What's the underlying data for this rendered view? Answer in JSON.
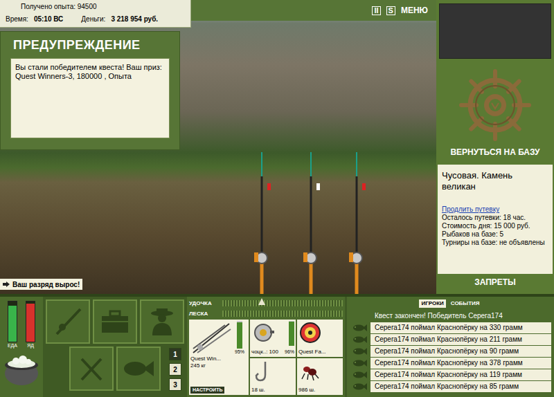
{
  "hud": {
    "experience": "Получено опыта: 94500",
    "time_label": "Время:",
    "time": "05:10 ВС",
    "money_label": "Деньги:",
    "money": "3 218 954 руб."
  },
  "top_bar": {
    "buttons": [
      "II",
      "S",
      "МЕНЮ"
    ]
  },
  "warning": {
    "title": "ПРЕДУПРЕЖДЕНИЕ",
    "message": "Вы стали победителем квеста! Ваш приз: Quest Winners-3, 180000 , Опыта"
  },
  "notification": "Ваш разряд вырос!",
  "base": {
    "return_button": "ВЕРНУТЬСЯ НА БАЗУ",
    "location": "Чусовая. Камень великан",
    "extend_link": "Продлить путевку",
    "details": [
      "Осталось путевки: 18 час.",
      "Стоимость дня: 15 000 руб.",
      "Рыбаков на базе: 5",
      "Турниры на базе: не объявлены"
    ],
    "bans_button": "ЗАПРЕТЫ"
  },
  "meters": [
    {
      "label": "ЕДА",
      "level": 0.9,
      "color": "#39b54a"
    },
    {
      "label": "ЯД",
      "level": 0.95,
      "color": "#d8322c"
    }
  ],
  "action_slots": [
    {
      "label": "1",
      "selected": true
    },
    {
      "label": "2",
      "selected": false
    },
    {
      "label": "3",
      "selected": false
    }
  ],
  "tension": [
    {
      "label": "УДОЧКА",
      "marker": true,
      "level": 0.3
    },
    {
      "label": "ЛЕСКА",
      "marker": false,
      "level": 0
    }
  ],
  "tackle": {
    "rod": {
      "name": "Quest Win...",
      "detail": "245 кг",
      "wear": "95%",
      "level": 0.95
    },
    "configure_button": "НАСТРОИТЬ",
    "items": [
      {
        "kind": "reel",
        "label": "чоцк..: 100",
        "wear": "96%",
        "level": 0.96
      },
      {
        "kind": "line",
        "label": "Quest Fa..."
      },
      {
        "kind": "hook",
        "label": "18 ш."
      },
      {
        "kind": "bait",
        "label": "986 ш."
      }
    ]
  },
  "feed": {
    "tabs": [
      {
        "label": "ИГРОКИ",
        "selected": true
      },
      {
        "label": "СОБЫТИЯ",
        "selected": false
      }
    ],
    "entries": [
      {
        "kind": "notice",
        "text": "Квест закончен! Победитель Серега174"
      },
      {
        "kind": "catch",
        "text": "Серега174 поймал Краснопёрку на 330 грамм"
      },
      {
        "kind": "catch",
        "text": "Серега174 поймал Краснопёрку на 211 грамм"
      },
      {
        "kind": "catch",
        "text": "Серега174 поймал Краснопёрку на 90 грамм"
      },
      {
        "kind": "catch",
        "text": "Серега174 поймал Краснопёрку на 378 грамм"
      },
      {
        "kind": "catch",
        "text": "Серега174 поймал Краснопёрку на 119 грамм"
      },
      {
        "kind": "catch",
        "text": "Серега174 поймал Краснопёрку на 85 грамм"
      }
    ]
  }
}
